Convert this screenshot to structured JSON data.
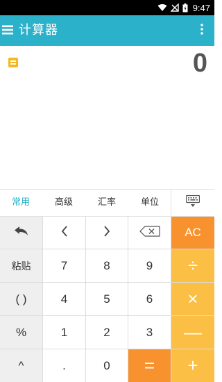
{
  "status_bar": {
    "time": "9:47"
  },
  "app_bar": {
    "title": "计算器"
  },
  "display": {
    "value": "0"
  },
  "tabs": [
    {
      "label": "常用",
      "active": true
    },
    {
      "label": "高级",
      "active": false
    },
    {
      "label": "汇率",
      "active": false
    },
    {
      "label": "单位",
      "active": false
    }
  ],
  "keypad": {
    "paste_label": "粘贴",
    "ac_label": "AC",
    "divide_label": "÷",
    "parens_label": "( )",
    "multiply_label": "×",
    "percent_label": "%",
    "minus_label": "—",
    "power_label": "^",
    "dot_label": ".",
    "equals_label": "=",
    "plus_label": "+",
    "digits": {
      "d0": "0",
      "d1": "1",
      "d2": "2",
      "d3": "3",
      "d4": "4",
      "d5": "5",
      "d6": "6",
      "d7": "7",
      "d8": "8",
      "d9": "9"
    }
  },
  "colors": {
    "app_bar": "#2bb1c9",
    "active_tab": "#2bb1c9",
    "ac_key": "#f8922f",
    "operator_key": "#fcbf45",
    "equals_key": "#f8922f"
  },
  "icons": [
    "wifi-icon",
    "no-signal-icon",
    "battery-icon",
    "menu-icon",
    "more-vert-icon",
    "history-icon",
    "keyboard-icon",
    "undo-icon",
    "cursor-left-icon",
    "cursor-right-icon",
    "backspace-icon"
  ]
}
